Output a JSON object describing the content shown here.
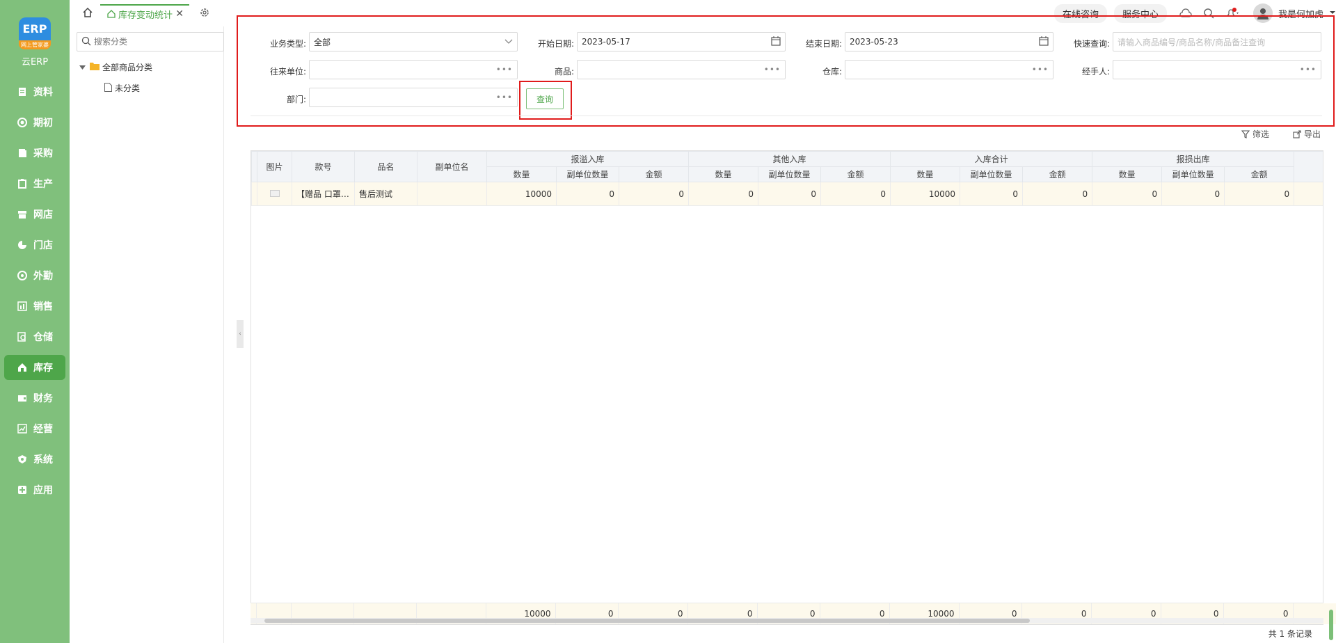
{
  "brand": {
    "logo_text": "ERP",
    "logo_tag": "网上管家婆",
    "name": "云ERP"
  },
  "nav": [
    {
      "label": "资料"
    },
    {
      "label": "期初"
    },
    {
      "label": "采购"
    },
    {
      "label": "生产"
    },
    {
      "label": "网店"
    },
    {
      "label": "门店"
    },
    {
      "label": "外勤"
    },
    {
      "label": "销售"
    },
    {
      "label": "仓储"
    },
    {
      "label": "库存"
    },
    {
      "label": "财务"
    },
    {
      "label": "经营"
    },
    {
      "label": "系统"
    },
    {
      "label": "应用"
    }
  ],
  "topbar": {
    "tab_label": "库存变动统计",
    "consult": "在线咨询",
    "service": "服务中心",
    "user": "我是何加虎"
  },
  "category": {
    "search_placeholder": "搜索分类",
    "root": "全部商品分类",
    "child": "未分类"
  },
  "filters": {
    "biz_type_label": "业务类型:",
    "biz_type_value": "全部",
    "start_label": "开始日期:",
    "start_value": "2023-05-17",
    "end_label": "结束日期:",
    "end_value": "2023-05-23",
    "quick_label": "快速查询:",
    "quick_placeholder": "请输入商品编号/商品名称/商品备注查询",
    "partner_label": "往来单位:",
    "goods_label": "商品:",
    "warehouse_label": "仓库:",
    "handler_label": "经手人:",
    "dept_label": "部门:",
    "query_button": "查询"
  },
  "tools": {
    "filter": "筛选",
    "export": "导出"
  },
  "table": {
    "headers": {
      "image": "图片",
      "style_no": "款号",
      "name": "品名",
      "sub_unit": "副单位名"
    },
    "groups": [
      "报溢入库",
      "其他入库",
      "入库合计",
      "报损出库"
    ],
    "sub": [
      "数量",
      "副单位数量",
      "金额"
    ],
    "row": {
      "style_no": "【赠品 口罩…",
      "name": "售后测试",
      "values": [
        "10000",
        "0",
        "0",
        "0",
        "0",
        "0",
        "10000",
        "0",
        "0",
        "0",
        "0",
        "0"
      ]
    },
    "totals": [
      "10000",
      "0",
      "0",
      "0",
      "0",
      "0",
      "10000",
      "0",
      "0",
      "0",
      "0",
      "0"
    ]
  },
  "footer": {
    "total": "共 1 条记录"
  }
}
